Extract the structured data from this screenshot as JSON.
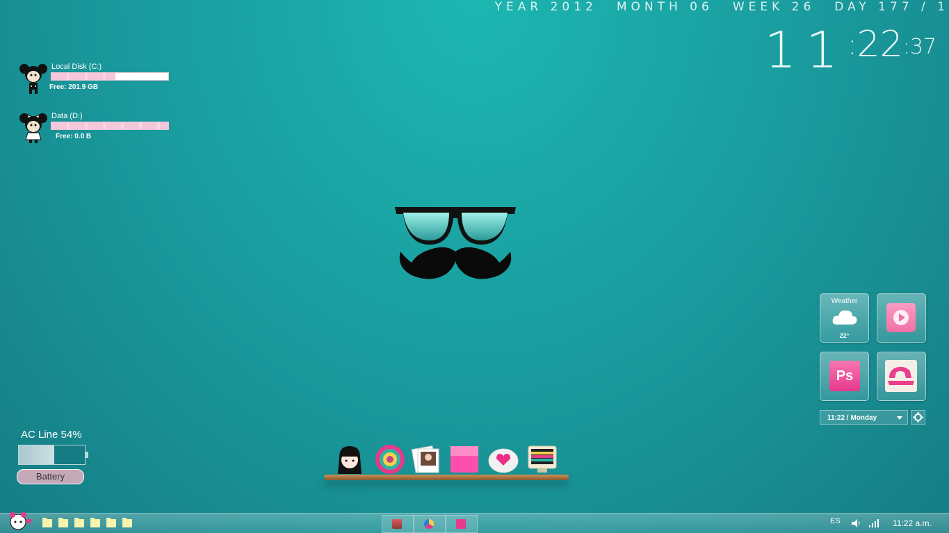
{
  "datebar": {
    "year": "YEAR 2012",
    "month": "MONTH 06",
    "week": "WEEK 26",
    "day": "DAY 177 / 1"
  },
  "clock": {
    "hours": "11",
    "sep": ":",
    "minutes": "22",
    "seconds": ":37"
  },
  "drives": [
    {
      "name": "Local Disk (C:)",
      "free": "Free: 201.9 GB",
      "used_fraction": 0.55
    },
    {
      "name": "Data (D:)",
      "free": "Free: 0.0 B",
      "used_fraction": 1.0
    }
  ],
  "battery": {
    "status": "AC Line 54%",
    "level_percent": 54,
    "button": "Battery"
  },
  "tiles": {
    "weather_label": "Weather",
    "weather_temp": "22°",
    "photoshop_label": "Ps"
  },
  "time_select": "11:22 / Monday",
  "taskbar": {
    "language": "ES",
    "time": "11:22 a.m."
  },
  "colors": {
    "accent_pink": "#ee4f9b",
    "wallpaper_teal": "#1a9ea0"
  }
}
